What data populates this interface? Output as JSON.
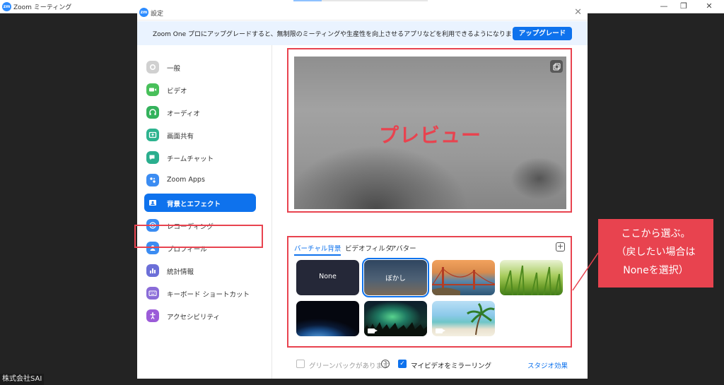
{
  "app_window": {
    "title": "Zoom ミーティング",
    "company_label": "株式会社SAI"
  },
  "dialog": {
    "title": "設定",
    "banner": {
      "text": "Zoom One プロにアップグレードすると、無制限のミーティングや生産性を向上させるアプリなどを利用できるようになります！",
      "button": "アップグレード"
    },
    "sidebar": {
      "items": [
        {
          "label": "一般",
          "icon": "gear-icon",
          "color": "#d0d0d0"
        },
        {
          "label": "ビデオ",
          "icon": "video-icon",
          "color": "#48c05a"
        },
        {
          "label": "オーディオ",
          "icon": "headphones-icon",
          "color": "#34b25c"
        },
        {
          "label": "画面共有",
          "icon": "share-screen-icon",
          "color": "#2db38f"
        },
        {
          "label": "チームチャット",
          "icon": "chat-icon",
          "color": "#2aae8e"
        },
        {
          "label": "Zoom Apps",
          "icon": "apps-icon",
          "color": "#3b8cf2"
        },
        {
          "label": "背景とエフェクト",
          "icon": "background-icon",
          "color": "#0e72ed"
        },
        {
          "label": "レコーディング",
          "icon": "record-icon",
          "color": "#3b8cf2"
        },
        {
          "label": "プロフィール",
          "icon": "profile-icon",
          "color": "#3b8cf2"
        },
        {
          "label": "統計情報",
          "icon": "stats-icon",
          "color": "#6c6fd8"
        },
        {
          "label": "キーボード ショートカット",
          "icon": "keyboard-icon",
          "color": "#8a6cd8"
        },
        {
          "label": "アクセシビリティ",
          "icon": "accessibility-icon",
          "color": "#9b5bd8"
        }
      ],
      "active_index": 6
    },
    "preview": {
      "label": "プレビュー"
    },
    "backgrounds": {
      "tabs": [
        "バーチャル背景",
        "ビデオフィルタ",
        "アバター"
      ],
      "active_tab": 0,
      "thumbnails": [
        {
          "label": "None"
        },
        {
          "label": "ぼかし",
          "selected": true
        },
        {
          "label": ""
        },
        {
          "label": ""
        },
        {
          "label": ""
        },
        {
          "label": ""
        },
        {
          "label": ""
        }
      ]
    },
    "options": {
      "green_screen": "グリーンバックがあります",
      "mirror": "マイビデオをミラーリング",
      "studio": "スタジオ効果"
    }
  },
  "callout": {
    "text": "ここから選ぶ。\n（戻したい場合は\nNoneを選択）"
  },
  "colors": {
    "accent": "#0e72ed",
    "annotation_red": "#e8434f"
  }
}
